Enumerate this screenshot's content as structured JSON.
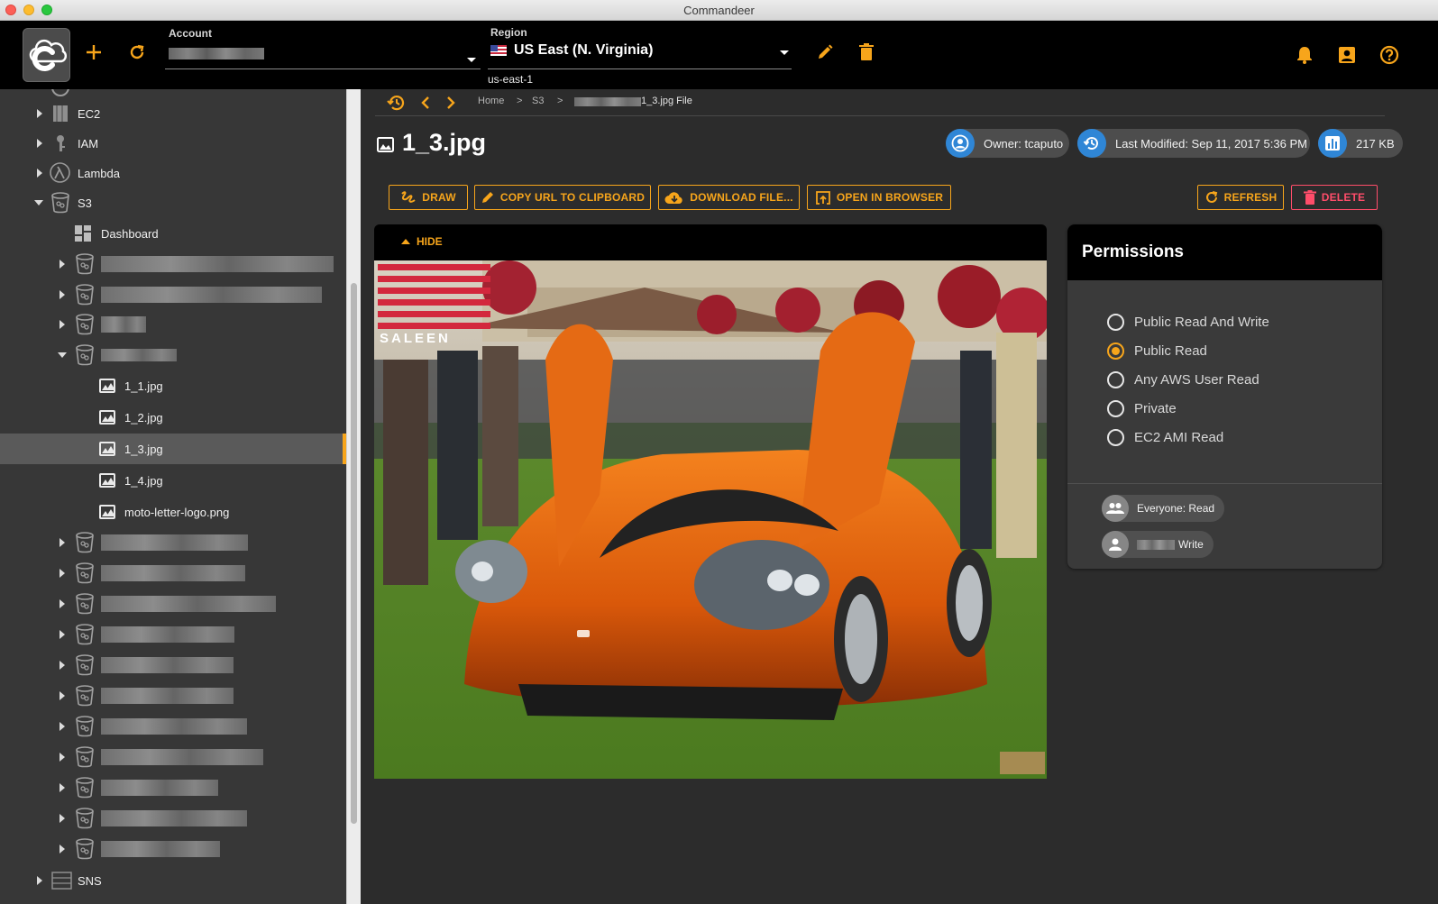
{
  "window": {
    "title": "Commandeer"
  },
  "header": {
    "account_label": "Account",
    "region_label": "Region",
    "region_value": "US East (N. Virginia)",
    "region_code": "us-east-1"
  },
  "sidebar": {
    "services": [
      {
        "label": "EC2"
      },
      {
        "label": "IAM"
      },
      {
        "label": "Lambda"
      },
      {
        "label": "S3"
      }
    ],
    "dashboard_label": "Dashboard",
    "files": [
      {
        "label": "1_1.jpg"
      },
      {
        "label": "1_2.jpg"
      },
      {
        "label": "1_3.jpg"
      },
      {
        "label": "1_4.jpg"
      },
      {
        "label": "moto-letter-logo.png"
      }
    ],
    "sns_label": "SNS"
  },
  "breadcrumb": {
    "home": "Home",
    "sep": ">",
    "s3": "S3",
    "file": "1_3.jpg File"
  },
  "file": {
    "name": "1_3.jpg",
    "owner": "Owner: tcaputo",
    "last_modified": "Last Modified: Sep 11, 2017 5:36 PM",
    "size": "217 KB"
  },
  "actions": {
    "draw": "DRAW",
    "copy_url": "COPY URL TO CLIPBOARD",
    "download": "DOWNLOAD FILE...",
    "open_browser": "OPEN IN BROWSER",
    "refresh": "REFRESH",
    "delete": "DELETE"
  },
  "preview": {
    "hide_label": "HIDE",
    "brand_text": "SALEEN"
  },
  "permissions": {
    "title": "Permissions",
    "options": [
      {
        "label": "Public Read And Write",
        "checked": false
      },
      {
        "label": "Public Read",
        "checked": true
      },
      {
        "label": "Any AWS User Read",
        "checked": false
      },
      {
        "label": "Private",
        "checked": false
      },
      {
        "label": "EC2 AMI Read",
        "checked": false
      }
    ],
    "grants": [
      {
        "label": "Everyone: Read"
      },
      {
        "label": "Write"
      }
    ]
  },
  "colors": {
    "accent": "#f7a51b",
    "danger": "#ff4d6a",
    "info": "#2f86d6"
  }
}
